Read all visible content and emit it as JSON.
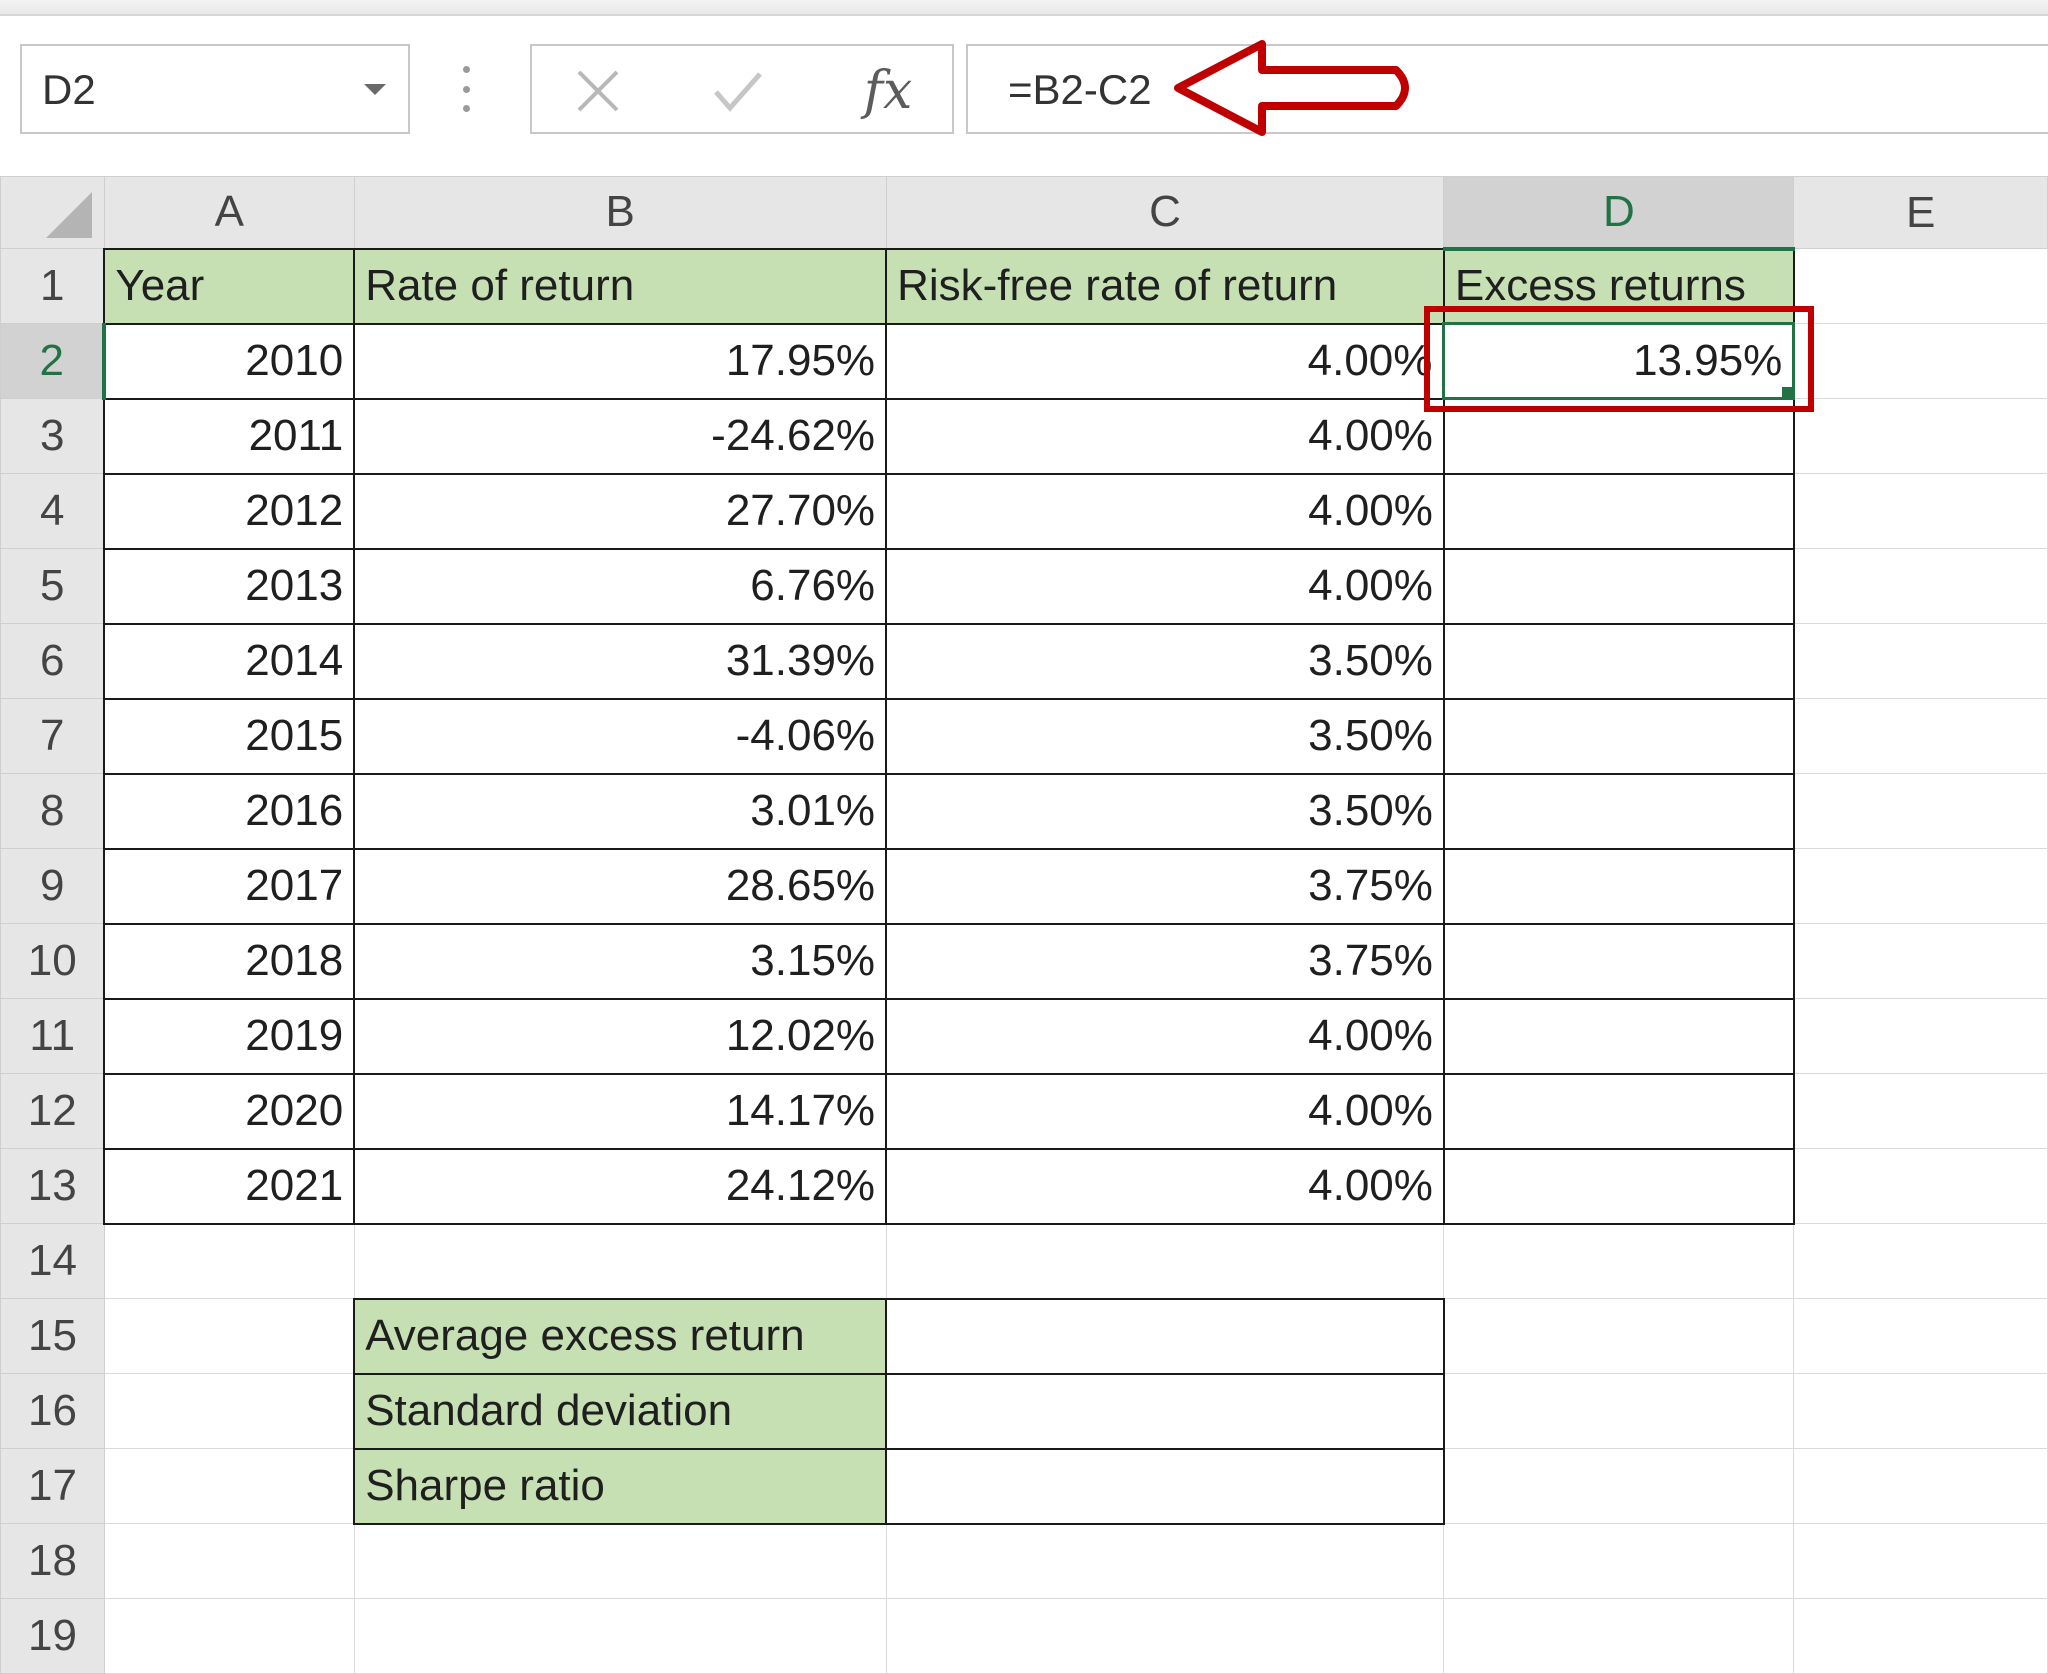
{
  "name_box": {
    "value": "D2"
  },
  "formula_bar": {
    "value": "=B2-C2",
    "fx_label": "fx"
  },
  "columns": [
    "A",
    "B",
    "C",
    "D",
    "E"
  ],
  "row_numbers": [
    "1",
    "2",
    "3",
    "4",
    "5",
    "6",
    "7",
    "8",
    "9",
    "10",
    "11",
    "12",
    "13",
    "14",
    "15",
    "16",
    "17",
    "18",
    "19"
  ],
  "header": {
    "year": "Year",
    "rate_of_return": "Rate of return",
    "risk_free": "Risk-free rate of return",
    "excess_returns": "Excess returns"
  },
  "rows": [
    {
      "year": "2010",
      "rate": "17.95%",
      "risk_free": "4.00%",
      "excess": "13.95%"
    },
    {
      "year": "2011",
      "rate": "-24.62%",
      "risk_free": "4.00%",
      "excess": ""
    },
    {
      "year": "2012",
      "rate": "27.70%",
      "risk_free": "4.00%",
      "excess": ""
    },
    {
      "year": "2013",
      "rate": "6.76%",
      "risk_free": "4.00%",
      "excess": ""
    },
    {
      "year": "2014",
      "rate": "31.39%",
      "risk_free": "3.50%",
      "excess": ""
    },
    {
      "year": "2015",
      "rate": "-4.06%",
      "risk_free": "3.50%",
      "excess": ""
    },
    {
      "year": "2016",
      "rate": "3.01%",
      "risk_free": "3.50%",
      "excess": ""
    },
    {
      "year": "2017",
      "rate": "28.65%",
      "risk_free": "3.75%",
      "excess": ""
    },
    {
      "year": "2018",
      "rate": "3.15%",
      "risk_free": "3.75%",
      "excess": ""
    },
    {
      "year": "2019",
      "rate": "12.02%",
      "risk_free": "4.00%",
      "excess": ""
    },
    {
      "year": "2020",
      "rate": "14.17%",
      "risk_free": "4.00%",
      "excess": ""
    },
    {
      "year": "2021",
      "rate": "24.12%",
      "risk_free": "4.00%",
      "excess": ""
    }
  ],
  "summary": [
    {
      "label": "Average excess return",
      "value": ""
    },
    {
      "label": "Standard deviation",
      "value": ""
    },
    {
      "label": "Sharpe ratio",
      "value": ""
    }
  ],
  "colors": {
    "accent": "#217346",
    "header_fill": "#c6e0b4",
    "annotation": "#c00000"
  },
  "icons": [
    "chevron-down-icon",
    "more-vertical-icon",
    "cancel-x-icon",
    "check-icon",
    "function-icon",
    "arrow-left-annotation-icon"
  ]
}
